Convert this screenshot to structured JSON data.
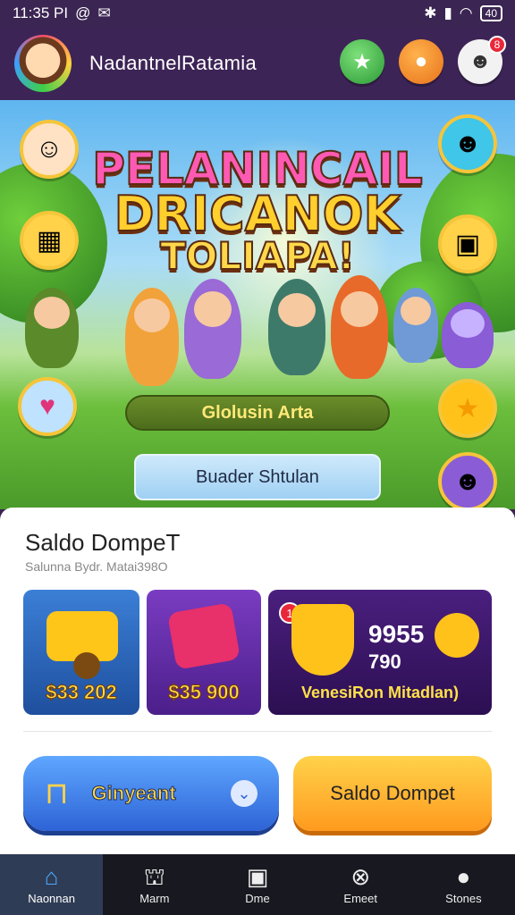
{
  "status_bar": {
    "time": "11:35 PI",
    "battery": "40"
  },
  "header": {
    "app_title": "NadantnelRatamia",
    "notification_count": "8"
  },
  "hero": {
    "title_line1": "PELANINCAIL",
    "title_line2": "DRICANOK",
    "title_line3": "TOLIAPA!",
    "primary_button": "Glolusin Arta",
    "secondary_button": "Buader Shtulan"
  },
  "wallet": {
    "title": "Saldo DompeT",
    "subtitle": "Salunna Bydr. Matai398O",
    "tiles": [
      {
        "price": "$33 202"
      },
      {
        "price": "$35 900"
      },
      {
        "amount_1": "9955",
        "amount_2": "790",
        "label": "VenesiRon Mitadlan)",
        "badge": "1"
      }
    ]
  },
  "actions": {
    "left_button": "Ginyeant",
    "right_button": "Saldo Dompet"
  },
  "bottom_nav": [
    {
      "label": "Naonnan",
      "icon": "home-icon"
    },
    {
      "label": "Marm",
      "icon": "store-icon"
    },
    {
      "label": "Dme",
      "icon": "card-icon"
    },
    {
      "label": "Emeet",
      "icon": "close-circle-icon"
    },
    {
      "label": "Stones",
      "icon": "profile-icon"
    }
  ],
  "colors": {
    "header_bg": "#3d2456",
    "nav_bg": "#181820",
    "accent_blue": "#2d63d6",
    "accent_orange": "#ff9a1e"
  }
}
